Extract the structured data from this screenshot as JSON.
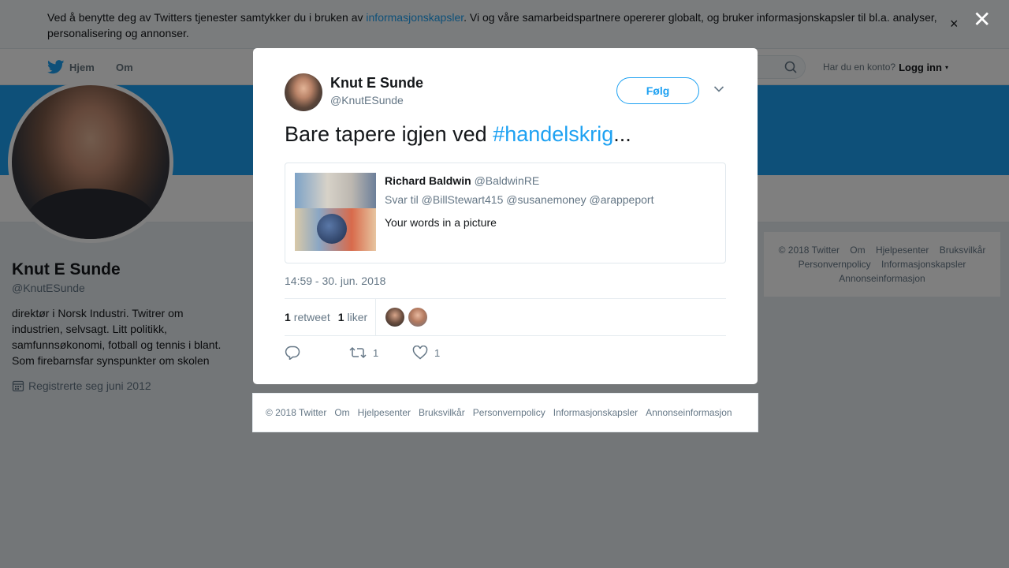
{
  "cookie_banner": {
    "text_before": "Ved å benytte deg av Twitters tjenester samtykker du i bruken av ",
    "link": "informasjonskapsler",
    "text_after": ". Vi og våre samarbeidspartnere opererer globalt, og bruker informasjonskapsler til bl.a. analyser, personalisering og annonser.",
    "close": "×"
  },
  "topnav": {
    "home": "Hjem",
    "about": "Om",
    "have_account": "Har du en konto?",
    "login": "Logg inn",
    "caret": "▾"
  },
  "profile": {
    "name": "Knut E Sunde",
    "handle": "@KnutESunde",
    "bio": "direktør i Norsk Industri. Twitrer om industrien, selvsagt. Litt politikk, samfunnsøkonomi, fotball og tennis i blant. Som firebarnsfar synspunkter om skolen",
    "joined": "Registrerte seg juni 2012"
  },
  "side_footer": {
    "links": [
      "© 2018 Twitter",
      "Om",
      "Hjelpesenter",
      "Bruksvilkår",
      "Personvernpolicy",
      "Informasjonskapsler",
      "Annonseinformasjon"
    ]
  },
  "overlay": {
    "close": "✕"
  },
  "tweet": {
    "author_name": "Knut E Sunde",
    "author_handle": "@KnutESunde",
    "follow_label": "Følg",
    "text_before": "Bare tapere igjen ved ",
    "hashtag": "#handelskrig",
    "text_after": "...",
    "quoted": {
      "author_name": "Richard Baldwin",
      "author_handle": "@BaldwinRE",
      "reply_to": "Svar til @BillStewart415 @susanemoney @arappeport",
      "text": "Your words in a picture"
    },
    "timestamp": "14:59 - 30. jun. 2018",
    "retweet_count": "1",
    "retweet_label": "retweet",
    "like_count": "1",
    "like_label": "liker",
    "action_retweet_count": "1",
    "action_like_count": "1"
  },
  "modal_footer": {
    "links": [
      "© 2018 Twitter",
      "Om",
      "Hjelpesenter",
      "Bruksvilkår",
      "Personvernpolicy",
      "Informasjonskapsler",
      "Annonseinformasjon"
    ]
  },
  "colors": {
    "accent": "#1da1f2",
    "banner": "#1da1f2",
    "text": "#14171a",
    "muted": "#657786"
  }
}
